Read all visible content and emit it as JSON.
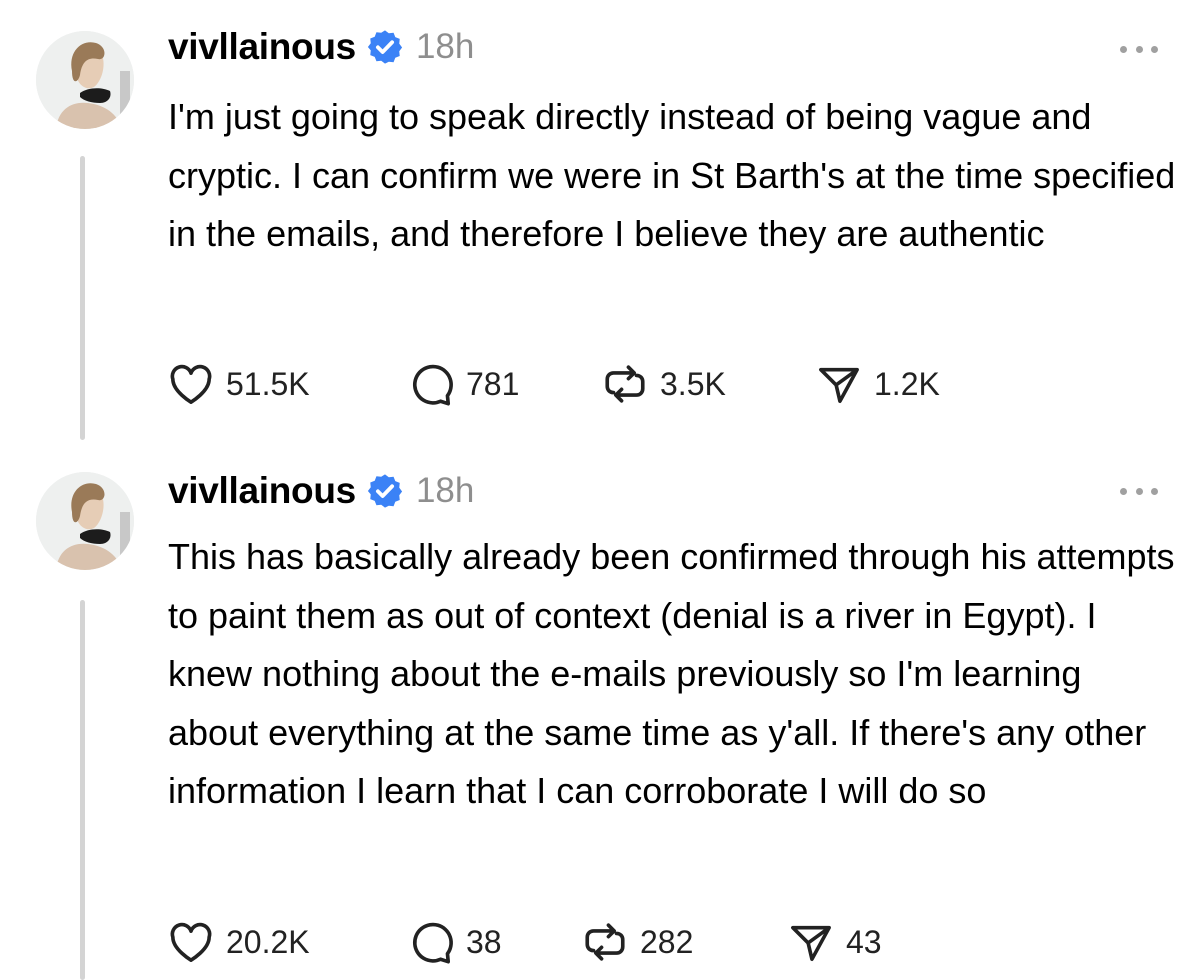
{
  "colors": {
    "verified": "#3B82F6",
    "timestamp": "#8E8E8E",
    "thread_line": "#D4D4D4",
    "text": "#000000"
  },
  "posts": [
    {
      "username": "vivllainous",
      "time": "18h",
      "text": "I'm just going to speak directly instead of being vague and cryptic. I can confirm we were in St Barth's at the time specified in the emails, and therefore I believe they are authentic",
      "likes": "51.5K",
      "replies": "781",
      "reposts": "3.5K",
      "shares": "1.2K",
      "icons": [
        "avatar",
        "verified-badge-icon",
        "more-options-icon",
        "heart-icon",
        "comment-icon",
        "repost-icon",
        "share-icon"
      ]
    },
    {
      "username": "vivllainous",
      "time": "18h",
      "text": "This has basically already been confirmed through his attempts to paint them as out of context (denial is a river in Egypt). I knew nothing about the e-mails previously so I'm learning about everything at the same time as y'all. If there's any other information I learn that I can corroborate I will do so",
      "likes": "20.2K",
      "replies": "38",
      "reposts": "282",
      "shares": "43",
      "icons": [
        "avatar",
        "verified-badge-icon",
        "more-options-icon",
        "heart-icon",
        "comment-icon",
        "repost-icon",
        "share-icon"
      ]
    }
  ]
}
